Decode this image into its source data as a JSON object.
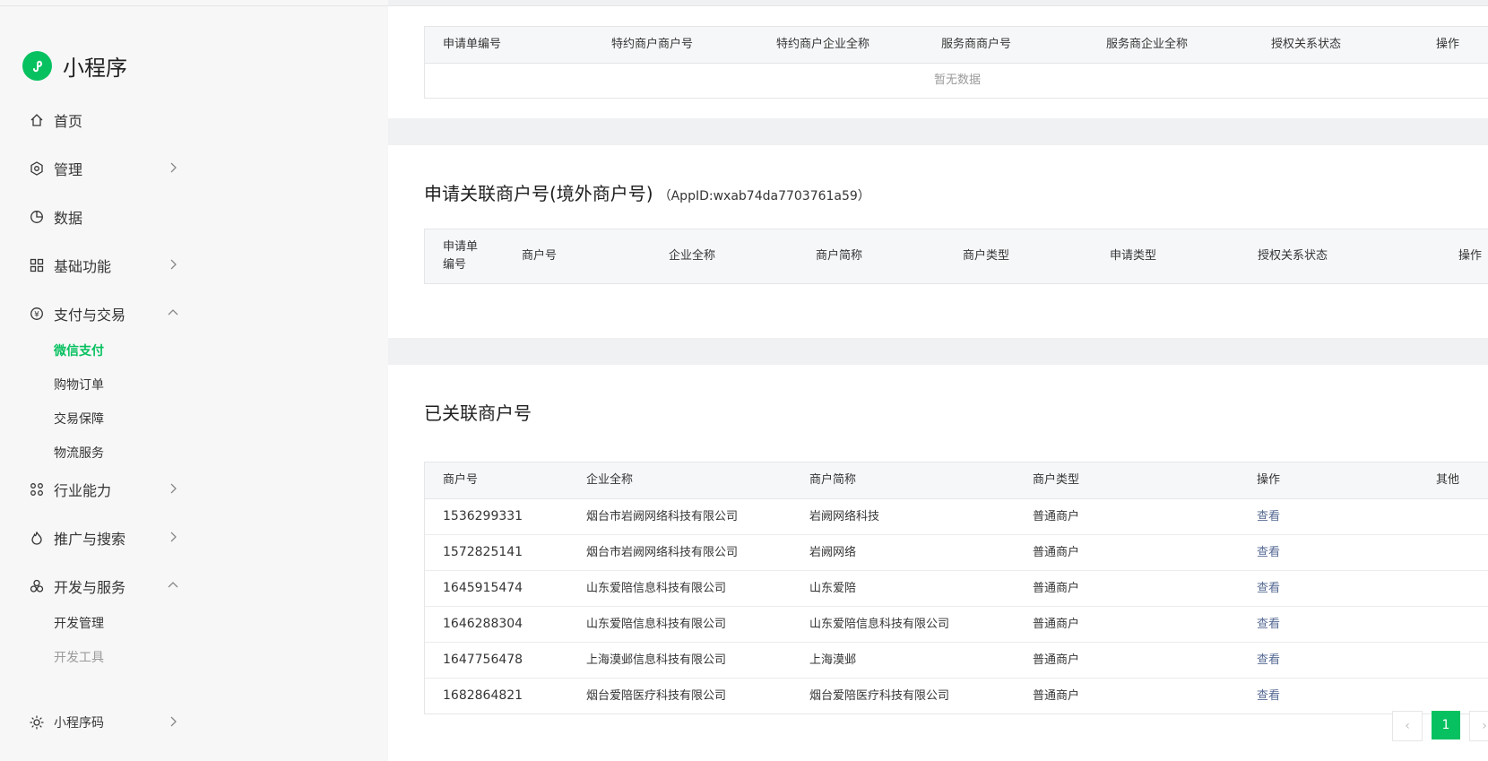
{
  "app": {
    "title": "小程序"
  },
  "sidebar": {
    "items": [
      {
        "label": "首页",
        "icon": "home-icon"
      },
      {
        "label": "管理",
        "icon": "settings-icon"
      },
      {
        "label": "数据",
        "icon": "chart-pie-icon"
      },
      {
        "label": "基础功能",
        "icon": "grid-icon"
      },
      {
        "label": "支付与交易",
        "icon": "yen-icon"
      },
      {
        "label": "行业能力",
        "icon": "nodes-icon"
      },
      {
        "label": "推广与搜索",
        "icon": "flame-icon"
      },
      {
        "label": "开发与服务",
        "icon": "cluster-icon"
      },
      {
        "label": "小程序码",
        "icon": "sun-icon"
      }
    ],
    "payment_sub": [
      "微信支付",
      "购物订单",
      "交易保障",
      "物流服务"
    ],
    "dev_sub": [
      "开发管理",
      "开发工具"
    ]
  },
  "top_table": {
    "headers": [
      "申请单编号",
      "特约商户商户号",
      "特约商户企业全称",
      "服务商商户号",
      "服务商企业全称",
      "授权关系状态",
      "操作"
    ],
    "empty_text": "暂无数据"
  },
  "overseas": {
    "title": "申请关联商户号(境外商户号)",
    "appid": "（AppID:wxab74da7703761a59）",
    "headers": [
      "申请单编号",
      "商户号",
      "企业全称",
      "商户简称",
      "商户类型",
      "申请类型",
      "授权关系状态",
      "操作"
    ],
    "header0_line1": "申请单",
    "header0_line2": "编号"
  },
  "linked": {
    "title": "已关联商户号",
    "headers": [
      "商户号",
      "企业全称",
      "商户简称",
      "商户类型",
      "操作",
      "其他"
    ],
    "rows": [
      {
        "id": "1536299331",
        "company": "烟台市岩阙网络科技有限公司",
        "short": "岩阙网络科技",
        "type": "普通商户",
        "action": "查看"
      },
      {
        "id": "1572825141",
        "company": "烟台市岩阙网络科技有限公司",
        "short": "岩阙网络",
        "type": "普通商户",
        "action": "查看"
      },
      {
        "id": "1645915474",
        "company": "山东爱陪信息科技有限公司",
        "short": "山东爱陪",
        "type": "普通商户",
        "action": "查看"
      },
      {
        "id": "1646288304",
        "company": "山东爱陪信息科技有限公司",
        "short": "山东爱陪信息科技有限公司",
        "type": "普通商户",
        "action": "查看"
      },
      {
        "id": "1647756478",
        "company": "上海漠邺信息科技有限公司",
        "short": "上海漠邺",
        "type": "普通商户",
        "action": "查看"
      },
      {
        "id": "1682864821",
        "company": "烟台爱陪医疗科技有限公司",
        "short": "烟台爱陪医疗科技有限公司",
        "type": "普通商户",
        "action": "查看"
      }
    ]
  },
  "pagination": {
    "current": "1",
    "prev": "‹",
    "next": "›"
  },
  "colors": {
    "accent": "#07c160",
    "link": "#576b95"
  }
}
